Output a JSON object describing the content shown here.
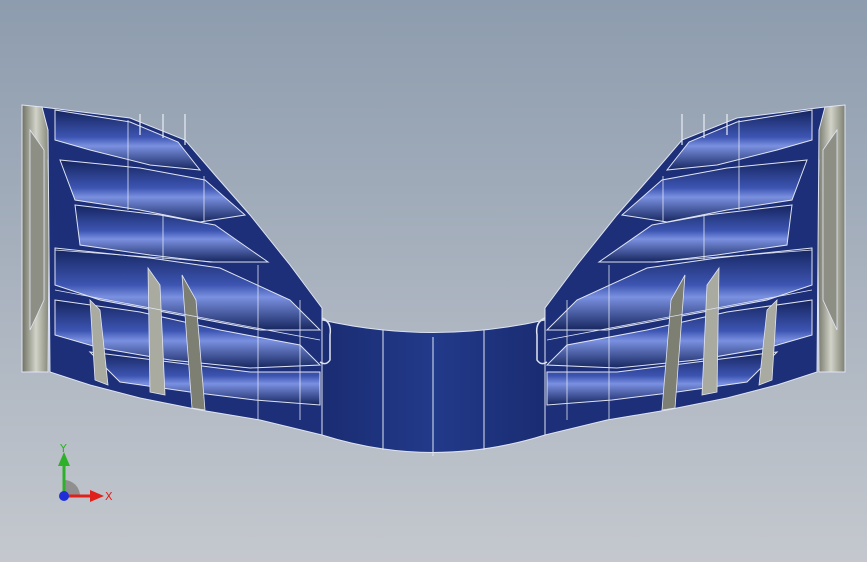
{
  "triad": {
    "x_label": "X",
    "y_label": "Y",
    "x_color": "#e0201a",
    "y_color": "#2fb02a",
    "z_color": "#1f2fd8",
    "icon": "coordinate-triad-icon"
  },
  "colors": {
    "background_top": "#8d9cae",
    "background_bottom": "#c4c8ce",
    "surface_blue": "#1c2f78",
    "surface_highlight": "#6f86d8",
    "edge_line": "#dfe4f2",
    "end_plate": "#a9aba0"
  }
}
